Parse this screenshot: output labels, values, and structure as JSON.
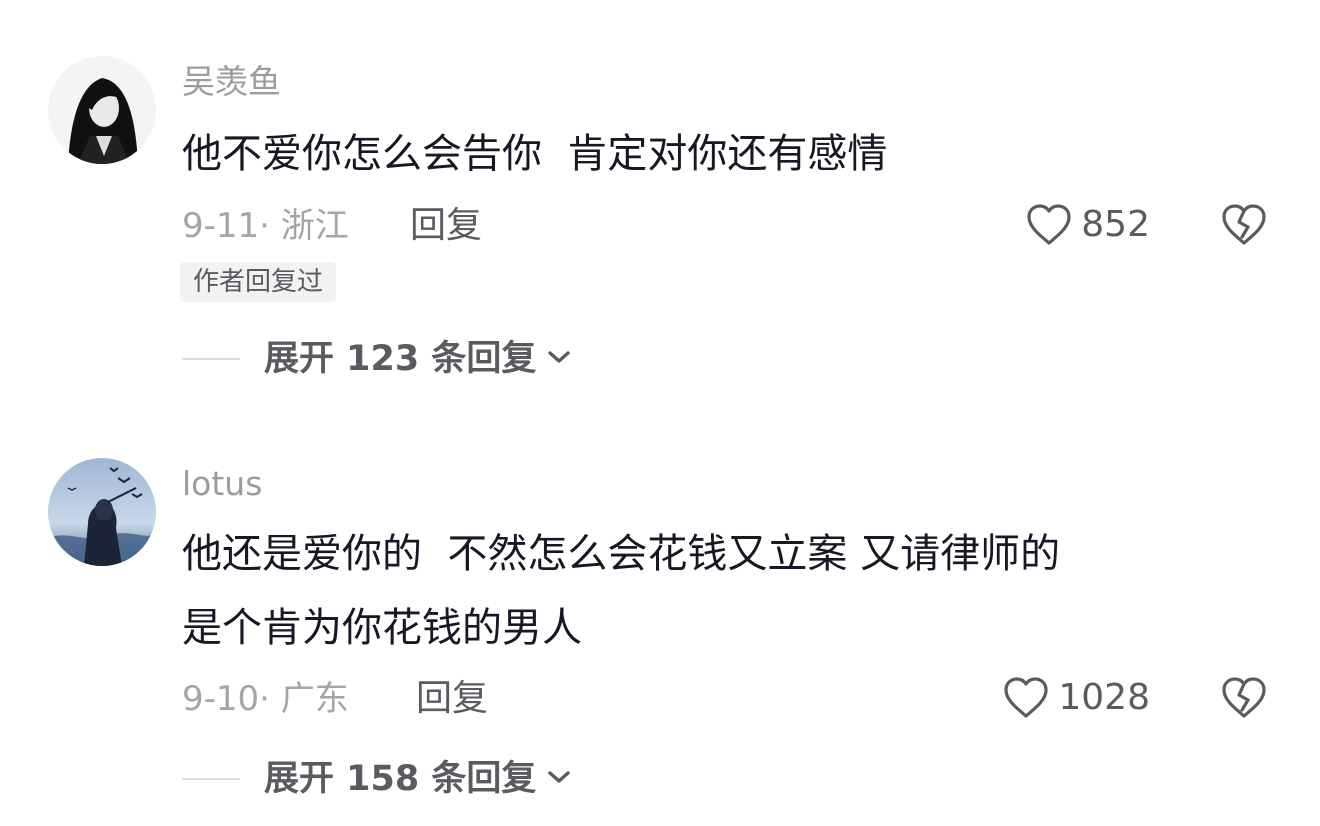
{
  "comments": [
    {
      "username": "吴羡鱼",
      "text_lines": [
        "他不爱你怎么会告你  肯定对你还有感情"
      ],
      "meta": "9-11· 浙江",
      "reply_label": "回复",
      "likes": "852",
      "author_tag": "作者回复过",
      "expand_label": "展开 123 条回复",
      "avatar_icon": "avatar-dark-haired-figure"
    },
    {
      "username": "lotus",
      "text_lines": [
        "他还是爱你的  不然怎么会花钱又立案 又请律师的",
        "是个肯为你花钱的男人"
      ],
      "meta": "9-10· 广东",
      "reply_label": "回复",
      "likes": "1028",
      "expand_label": "展开 158 条回复",
      "avatar_icon": "avatar-girl-with-birds"
    }
  ],
  "icons": {
    "like": "heart-outline-icon",
    "dislike": "broken-heart-icon",
    "expand": "chevron-down-icon"
  },
  "colors": {
    "primary_text": "#161823",
    "secondary_text": "#9b9ca0",
    "action_text": "#5a5b61",
    "tag_bg": "#f2f2f3"
  }
}
